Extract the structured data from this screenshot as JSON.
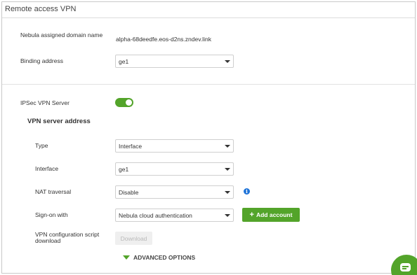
{
  "panel": {
    "title": "Remote access VPN"
  },
  "domain": {
    "label": "Nebula assigned domain name",
    "value": "alpha-68deedfe.eos-d2ns.zndev.link"
  },
  "binding": {
    "label": "Binding address",
    "value": "ge1"
  },
  "ipsec": {
    "label": "IPSec VPN Server",
    "enabled": true
  },
  "vpn_server": {
    "heading": "VPN server address",
    "type": {
      "label": "Type",
      "value": "Interface"
    },
    "interface": {
      "label": "Interface",
      "value": "ge1"
    },
    "nat": {
      "label": "NAT traversal",
      "value": "Disable",
      "info_icon": "info-icon"
    },
    "signon": {
      "label": "Sign-on with",
      "value": "Nebula cloud authentication",
      "add_button": "Add account"
    },
    "config": {
      "label": "VPN configuration script download",
      "download_button": "Download"
    }
  },
  "advanced": {
    "label": "ADVANCED OPTIONS"
  },
  "colors": {
    "accent": "#53a42a",
    "info": "#1e73d8"
  },
  "icons": {
    "chat": "chat-icon",
    "caret": "chevron-down-icon",
    "plus": "plus-icon",
    "toggle_triangle": "triangle-down-icon"
  }
}
